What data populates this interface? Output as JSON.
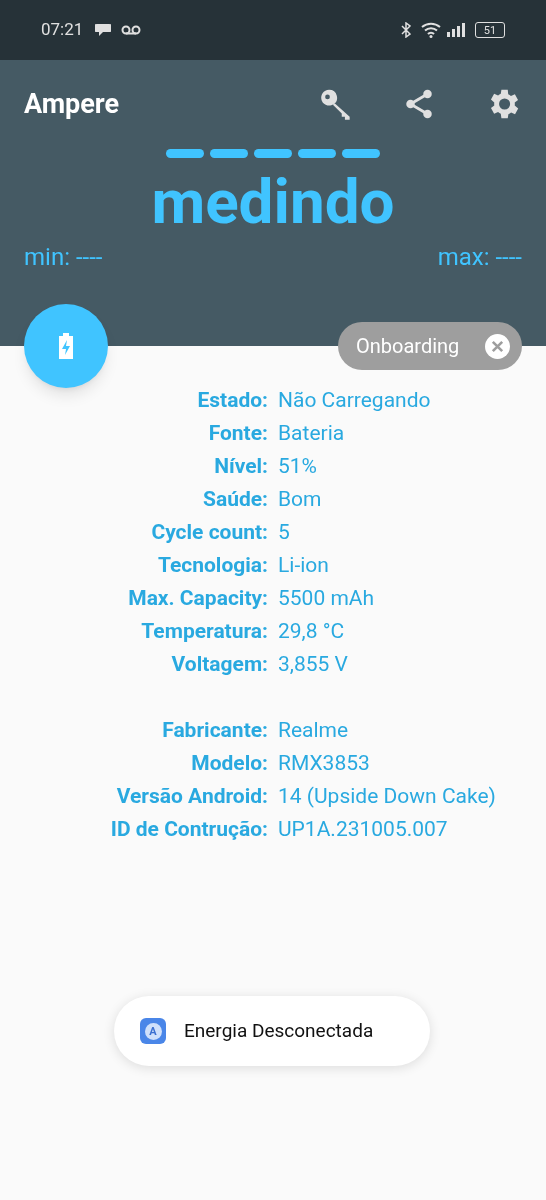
{
  "status_bar": {
    "time": "07:21",
    "battery": "51"
  },
  "app_bar": {
    "title": "Ampere"
  },
  "reading": {
    "value": "medindo",
    "min": "min: ----",
    "max": "max: ----"
  },
  "chip": {
    "label": "Onboarding"
  },
  "info_groups": [
    [
      {
        "label": "Estado:",
        "value": "Não Carregando"
      },
      {
        "label": "Fonte:",
        "value": "Bateria"
      },
      {
        "label": "Nível:",
        "value": "51%"
      },
      {
        "label": "Saúde:",
        "value": "Bom"
      },
      {
        "label": "Cycle count:",
        "value": "5"
      },
      {
        "label": "Tecnologia:",
        "value": "Li-ion"
      },
      {
        "label": "Max. Capacity:",
        "value": "5500 mAh"
      },
      {
        "label": "Temperatura:",
        "value": "29,8 °C"
      },
      {
        "label": "Voltagem:",
        "value": "3,855 V"
      }
    ],
    [
      {
        "label": "Fabricante:",
        "value": "Realme"
      },
      {
        "label": "Modelo:",
        "value": "RMX3853"
      },
      {
        "label": "Versão Android:",
        "value": "14 (Upside Down Cake)"
      },
      {
        "label": "ID de Contrução:",
        "value": "UP1A.231005.007"
      }
    ]
  ],
  "toast": {
    "app_icon_letter": "A",
    "message": "Energia Desconectada"
  }
}
